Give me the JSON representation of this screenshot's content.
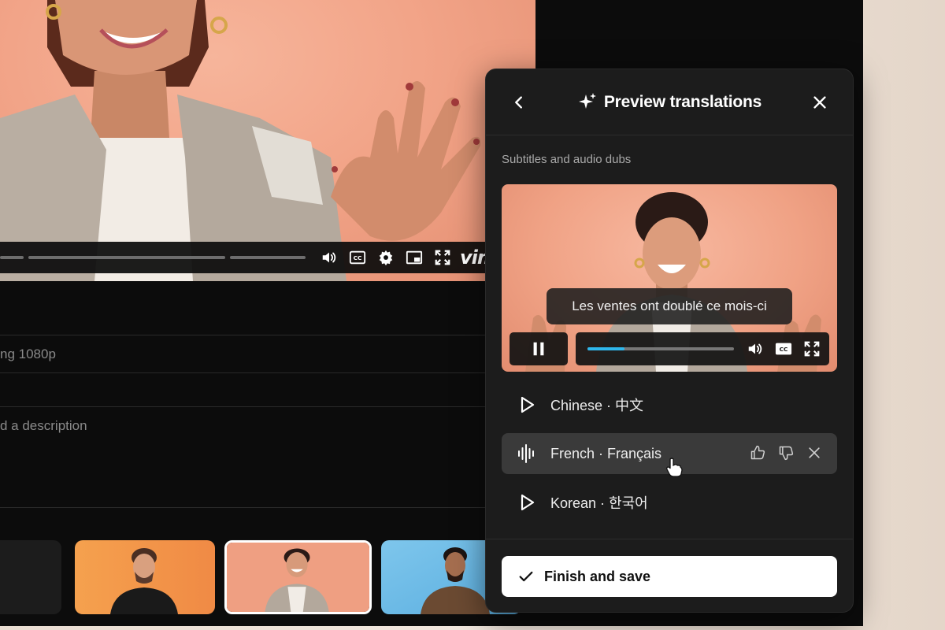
{
  "main": {
    "quality_text": "ng 1080p",
    "description_placeholder": "d a description",
    "player_controls": {
      "icons": [
        "volume-icon",
        "captions-icon",
        "settings-icon",
        "pip-icon",
        "fullscreen-icon"
      ],
      "brand": "vim"
    },
    "thumbnails": [
      "thumbnail-1",
      "thumbnail-2",
      "thumbnail-3",
      "thumbnail-4"
    ]
  },
  "panel": {
    "title": "Preview translations",
    "section_label": "Subtitles and audio dubs",
    "preview": {
      "subtitle": "Les ventes ont doublé ce mois-ci",
      "progress": 0.25
    },
    "languages": [
      {
        "label": "Chinese · 中文",
        "state": "idle"
      },
      {
        "label": "French · Français",
        "state": "playing"
      },
      {
        "label": "Korean · 한국어",
        "state": "idle"
      }
    ],
    "finish_label": "Finish and save"
  },
  "colors": {
    "accent": "#2fb7ec",
    "panel_bg": "#1c1c1c",
    "active_row": "#3a3a3a"
  }
}
